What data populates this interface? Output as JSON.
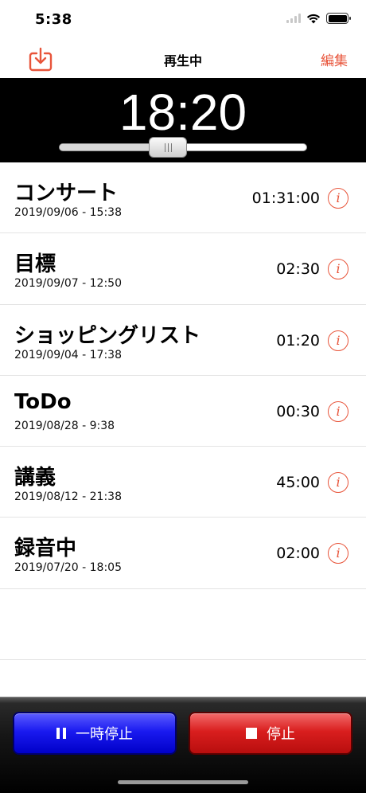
{
  "status": {
    "time": "5:38"
  },
  "nav": {
    "title": "再生中",
    "edit_label": "編集",
    "import_icon": "import-download-icon"
  },
  "player": {
    "time": "18:20",
    "progress": 0.44
  },
  "recordings": [
    {
      "title": "コンサート",
      "date": "2019/09/06 - 15:38",
      "duration": "01:31:00"
    },
    {
      "title": "目標",
      "date": "2019/09/07 - 12:50",
      "duration": "02:30"
    },
    {
      "title": "ショッピングリスト",
      "date": "2019/09/04 - 17:38",
      "duration": "01:20"
    },
    {
      "title": "ToDo",
      "date": "2019/08/28 - 9:38",
      "duration": "00:30"
    },
    {
      "title": "講義",
      "date": "2019/08/12 - 21:38",
      "duration": "45:00"
    },
    {
      "title": "録音中",
      "date": "2019/07/20 - 18:05",
      "duration": "02:00"
    }
  ],
  "toolbar": {
    "pause_label": "一時停止",
    "stop_label": "停止"
  },
  "colors": {
    "accent": "#e8553b",
    "pause_button": "#1a1af0",
    "stop_button": "#d91e1e"
  }
}
